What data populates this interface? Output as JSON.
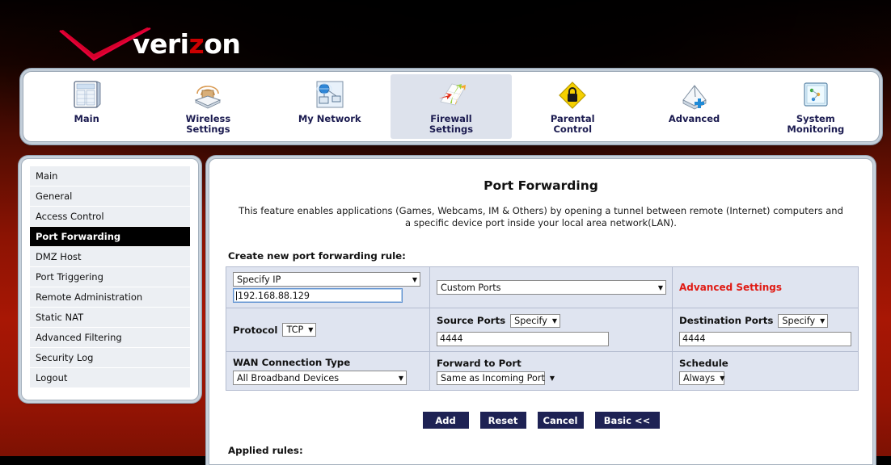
{
  "brand": {
    "logo_text_pre": "veri",
    "logo_text_z": "z",
    "logo_text_post": "on",
    "logo_checkmark_icon": "verizon-checkmark-icon",
    "accent_red": "#cc0000"
  },
  "topnav": {
    "tabs": [
      {
        "label": "Main",
        "icon": "main-grid-icon",
        "active": false
      },
      {
        "label": "Wireless\nSettings",
        "icon": "wireless-router-icon",
        "active": false
      },
      {
        "label": "My Network",
        "icon": "network-computers-icon",
        "active": false
      },
      {
        "label": "Firewall\nSettings",
        "icon": "firewall-arrows-icon",
        "active": true
      },
      {
        "label": "Parental\nControl",
        "icon": "parental-lock-icon",
        "active": false
      },
      {
        "label": "Advanced",
        "icon": "advanced-plus-icon",
        "active": false
      },
      {
        "label": "System\nMonitoring",
        "icon": "system-monitor-icon",
        "active": false
      }
    ]
  },
  "sidebar": {
    "items": [
      {
        "label": "Main",
        "active": false
      },
      {
        "label": "General",
        "active": false
      },
      {
        "label": "Access Control",
        "active": false
      },
      {
        "label": "Port Forwarding",
        "active": true
      },
      {
        "label": "DMZ Host",
        "active": false
      },
      {
        "label": "Port Triggering",
        "active": false
      },
      {
        "label": "Remote Administration",
        "active": false
      },
      {
        "label": "Static NAT",
        "active": false
      },
      {
        "label": "Advanced Filtering",
        "active": false
      },
      {
        "label": "Security Log",
        "active": false
      },
      {
        "label": "Logout",
        "active": false
      }
    ]
  },
  "main": {
    "title": "Port Forwarding",
    "description": "This feature enables applications (Games, Webcams, IM & Others) by opening a tunnel between remote (Internet) computers and a specific device port inside your local area network(LAN).",
    "form_heading": "Create new port forwarding rule:",
    "applied_rules_heading": "Applied rules:"
  },
  "form": {
    "ip_mode_select": "Specify IP",
    "ip_value": "192.168.88.129",
    "ports_profile_select": "Custom Ports",
    "advanced_settings_link": "Advanced Settings",
    "protocol_label": "Protocol",
    "protocol_select": "TCP",
    "source_ports_label": "Source Ports",
    "source_ports_mode": "Specify",
    "source_ports_value": "4444",
    "destination_ports_label": "Destination Ports",
    "destination_ports_mode": "Specify",
    "destination_ports_value": "4444",
    "wan_connection_label": "WAN Connection Type",
    "wan_connection_select": "All Broadband Devices",
    "forward_to_port_label": "Forward to Port",
    "forward_to_port_select": "Same as Incoming Port",
    "schedule_label": "Schedule",
    "schedule_select": "Always",
    "caret_glyph": "▼"
  },
  "buttons": {
    "add": "Add",
    "reset": "Reset",
    "cancel": "Cancel",
    "basic": "Basic <<"
  }
}
